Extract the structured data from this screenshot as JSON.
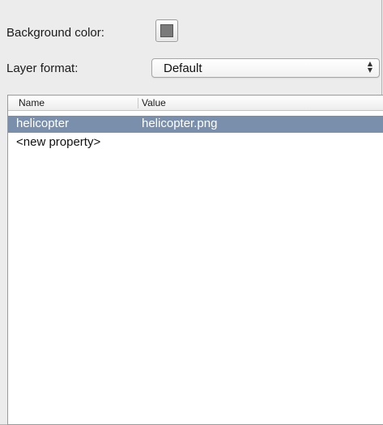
{
  "properties_panel": {
    "background_color": {
      "label": "Background color:",
      "swatch_color": "#7a7a7a"
    },
    "layer_format": {
      "label": "Layer format:",
      "selected_value": "Default"
    },
    "table": {
      "columns": [
        "Name",
        "Value"
      ],
      "rows": [
        {
          "name": "helicopter",
          "value": "helicopter.png",
          "selected": true
        },
        {
          "name": "<new property>",
          "value": "",
          "selected": false
        }
      ]
    }
  }
}
